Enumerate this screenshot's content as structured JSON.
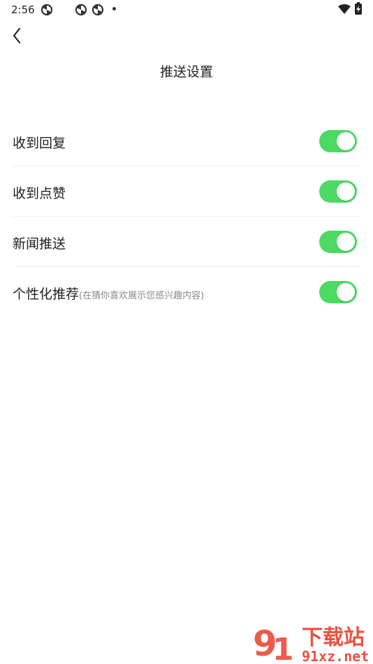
{
  "status_bar": {
    "time": "2:56",
    "icons": [
      "app-notification-icon",
      "app-notification-icon",
      "app-notification-icon",
      "dot-icon",
      "wifi-icon",
      "battery-charging-icon"
    ]
  },
  "header": {
    "back_icon": "chevron-left-icon",
    "title": "推送设置"
  },
  "settings": [
    {
      "label": "收到回复",
      "sub": "",
      "enabled": true
    },
    {
      "label": "收到点赞",
      "sub": "",
      "enabled": true
    },
    {
      "label": "新闻推送",
      "sub": "",
      "enabled": true
    },
    {
      "label": "个性化推荐",
      "sub": "(在猜你喜欢展示您感兴趣内容)",
      "enabled": true
    }
  ],
  "colors": {
    "toggle_on": "#4cd964",
    "watermark_red": "#e8402f"
  },
  "watermark": {
    "text": "下载站",
    "url_text": "91xz.net"
  }
}
